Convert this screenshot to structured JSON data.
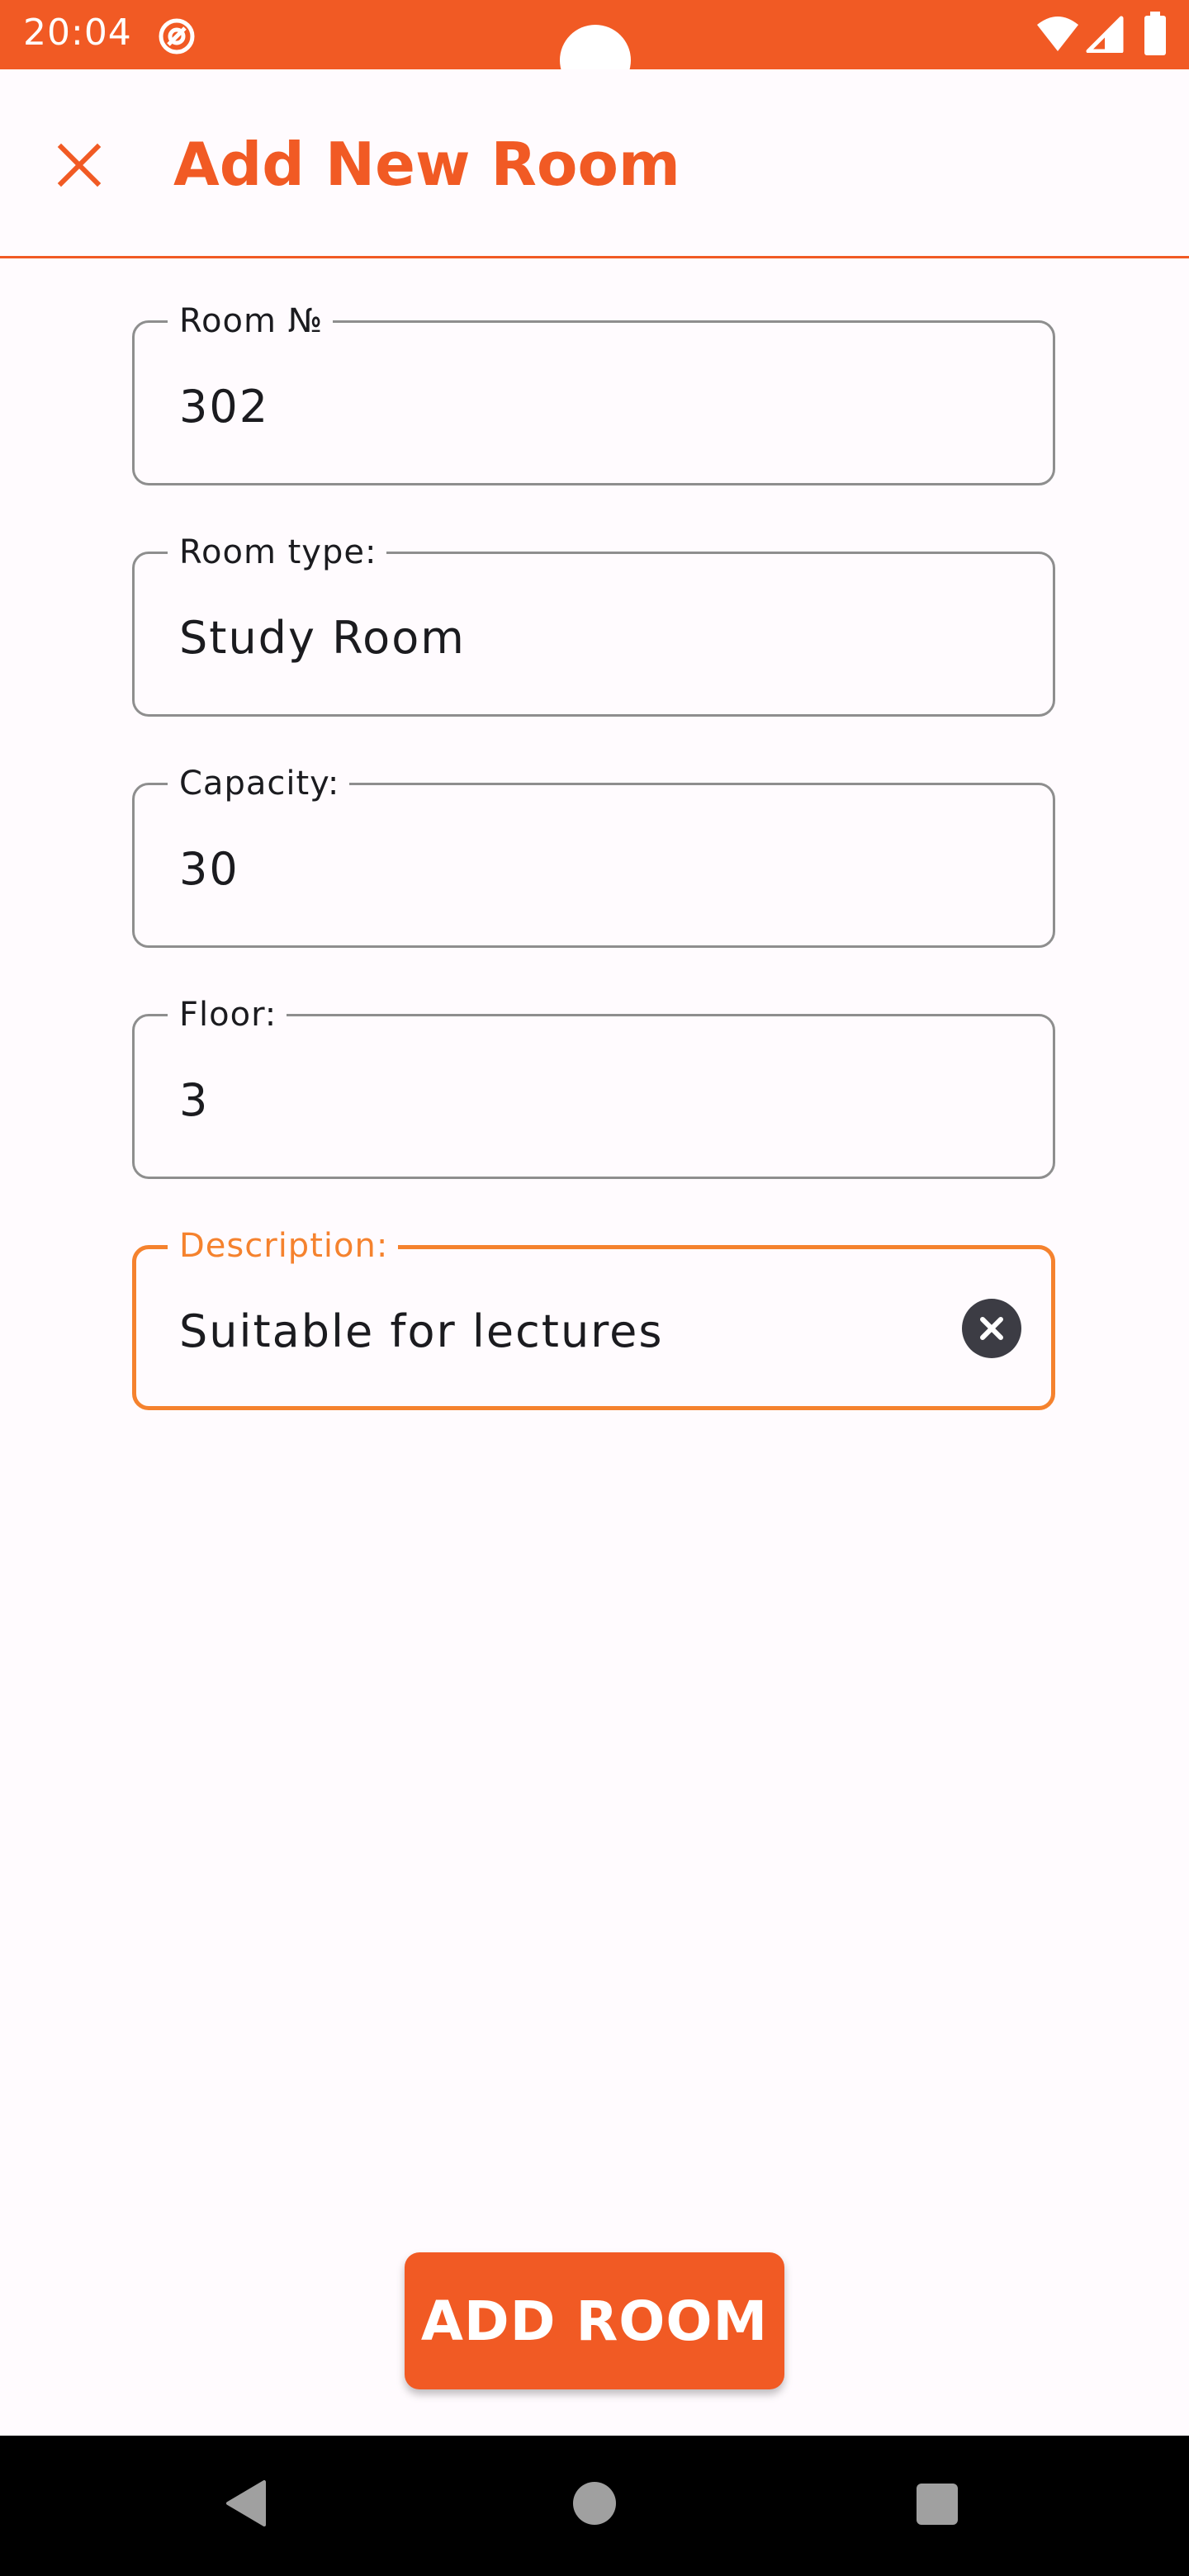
{
  "status_bar": {
    "time": "20:04",
    "notification_icon": "at-sign-icon",
    "wifi_icon": "wifi-icon",
    "signal_icon": "signal-icon",
    "battery_icon": "battery-icon"
  },
  "app_bar": {
    "title": "Add New Room",
    "close_icon": "close-icon"
  },
  "form": {
    "room_number": {
      "label": "Room №",
      "value": "302"
    },
    "room_type": {
      "label": "Room type:",
      "value": "Study Room"
    },
    "capacity": {
      "label": "Capacity:",
      "value": "30"
    },
    "floor": {
      "label": "Floor:",
      "value": "3"
    },
    "description": {
      "label": "Description:",
      "value": "Suitable for lectures",
      "focused": true,
      "clear_icon": "clear-circle-icon"
    }
  },
  "actions": {
    "add_room_label": "ADD ROOM"
  },
  "nav_bar": {
    "back_icon": "back-triangle-icon",
    "home_icon": "home-circle-icon",
    "recents_icon": "recents-square-icon"
  },
  "colors": {
    "brand": "#f15a24",
    "focus_accent": "#f5822e",
    "outline": "#8e8e8e",
    "background": "#fffbfe",
    "text": "#1b1b1f"
  }
}
